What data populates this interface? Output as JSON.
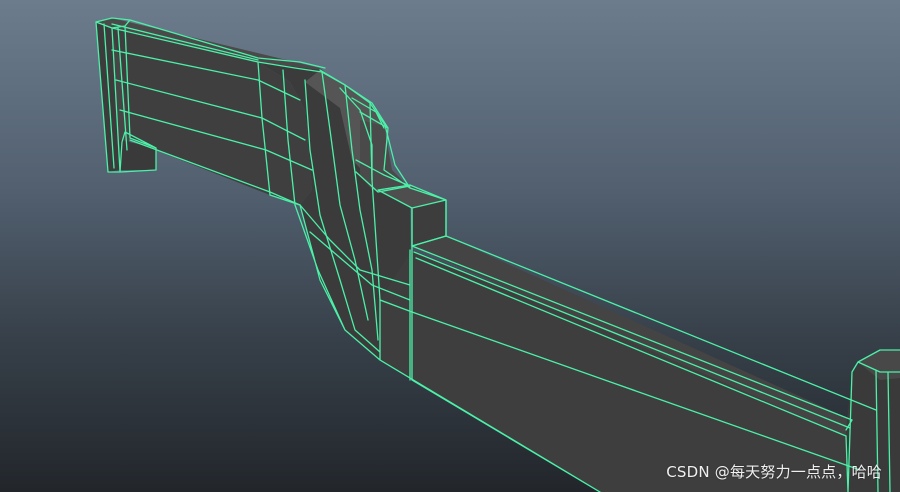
{
  "viewport": {
    "background_top": "#6c7c8c",
    "background_bottom": "#22262b",
    "mesh_face_color": "#3e3e3e",
    "mesh_face_dark": "#343434",
    "wireframe_color": "#4cf0a8"
  },
  "watermark": {
    "text": "CSDN @每天努力一点点，哈哈"
  }
}
